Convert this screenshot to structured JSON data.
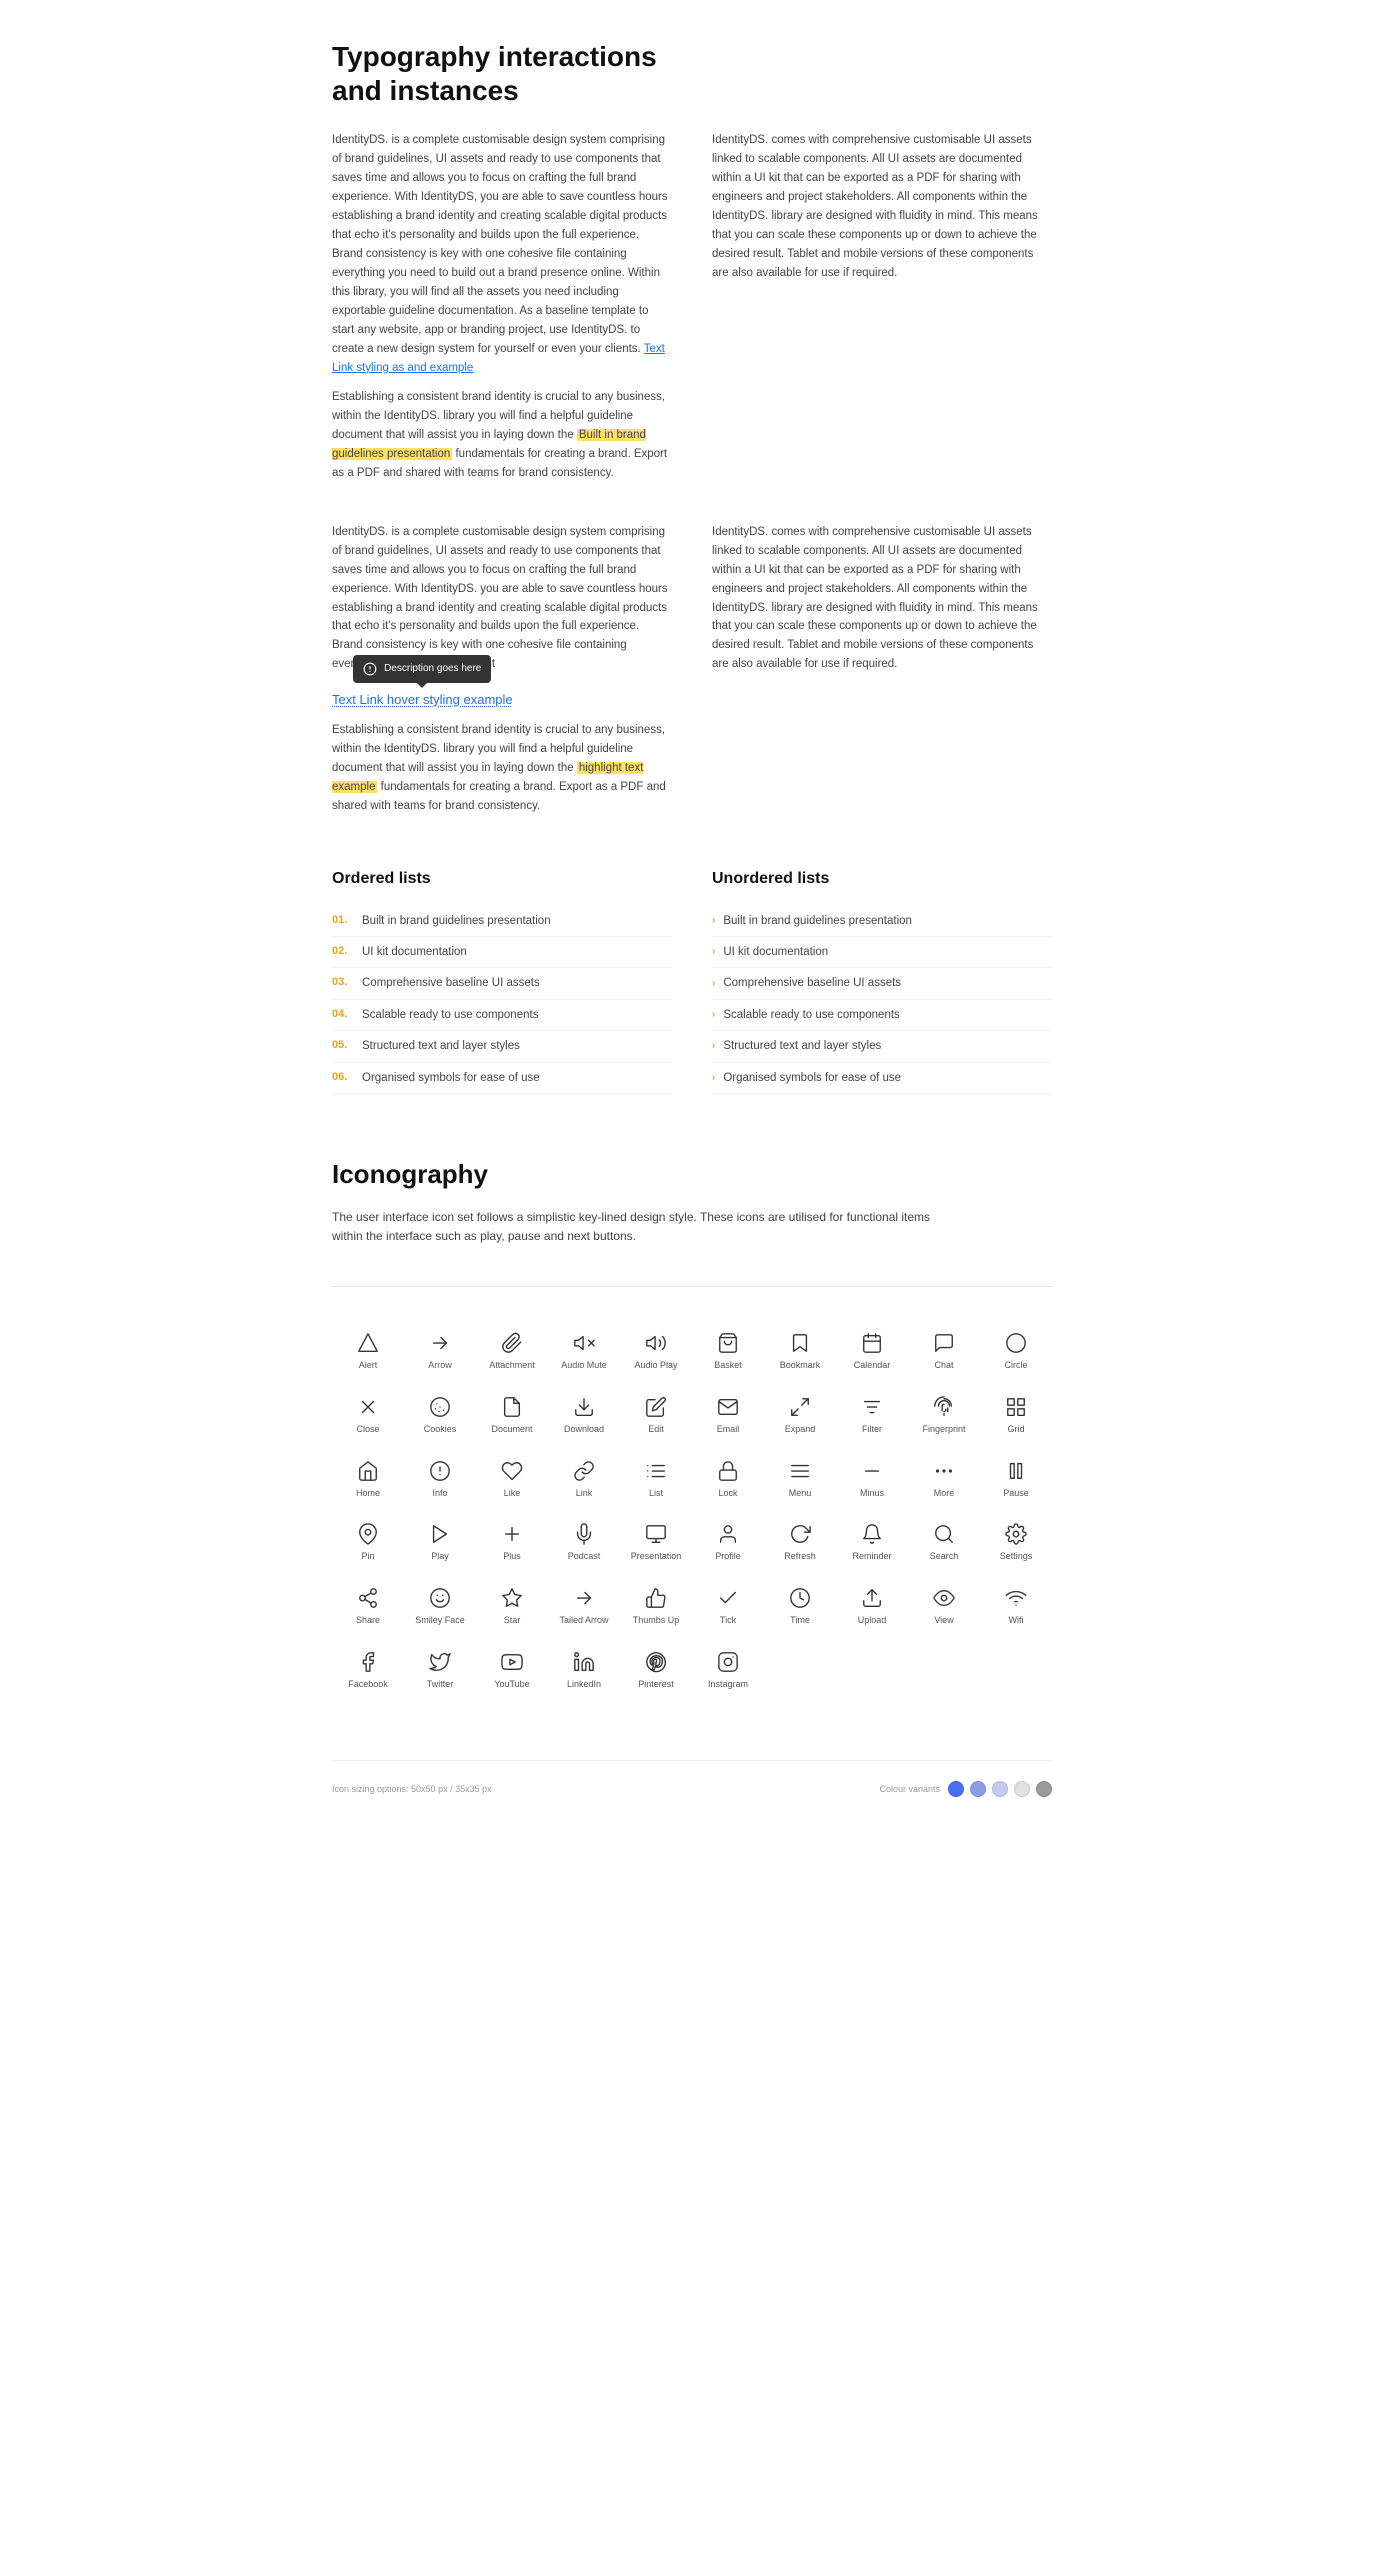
{
  "typography": {
    "title": "Typography interactions\nand instances",
    "col1_p1": "IdentityDS. is a complete customisable design system comprising of brand guidelines, UI assets and ready to use components that saves time and allows you to focus on crafting the full brand experience. With IdentityDS. you are able to save countless hours establishing a brand identity and creating scalable digital products that echo it's personality and builds upon the full experience. Brand consistency is key with one cohesive file containing everything you need to build out a brand presence online. Within this library, you will find all the assets you need including exportable guideline documentation. As a baseline template to start any website, app or branding project, use IdentityDS. to create a new design system for yourself or even your clients.",
    "col1_link": "Text Link styling as and example",
    "col1_p2": "Establishing a consistent brand identity is crucial to any business, within the IdentityDS. library you will find a helpful guideline document that will assist you in laying down the",
    "col1_highlight": "highlight text example",
    "col1_p3": "fundamentals for creating a brand. Export as a PDF and shared with teams for brand consistency.",
    "col2_p1": "IdentityDS. comes with comprehensive customisable UI assets linked to scalable components. All UI assets are documented within a UI kit that can be exported as a PDF for sharing with engineers and project stakeholders. All components within the IdentityDS. library are designed with fluidity in mind. This means that you can scale these components up or down to achieve the desired result. Tablet and mobile versions of these components are also available for use if required.",
    "col1b_p1": "IdentityDS. is a complete customisable design system comprising of brand guidelines, UI assets and ready to use components that saves time and allows you to focus on crafting the full brand experience. With IdentityDS. you are able to save countless hours establishing a brand identity and creating scalable digital products that echo it's personality and builds upon the full experience. Brand consistency is key with one cohesive file containing everything you need to build out",
    "col1b_link": "Text Link hover styling example",
    "col1b_p2": "Establishing a consistent brand identity is crucial to any business, within the IdentityDS. library you will find a helpful guideline document that will assist you in laying down the",
    "col1b_highlight": "highlight text example",
    "col1b_p3": "fundamentals for creating a brand. Export as a PDF and shared with teams for brand consistency.",
    "col2b_p1": "IdentityDS. comes with comprehensive customisable UI assets linked to scalable components. All UI assets are documented within a UI kit that can be exported as a PDF for sharing with engineers and project stakeholders. All components within the IdentityDS. library are designed with fluidity in mind. This means that you can scale these components up or down to achieve the desired result. Tablet and mobile versions of these components are also available for use if required.",
    "tooltip_text": "Description goes here"
  },
  "lists": {
    "ordered_title": "Ordered lists",
    "unordered_title": "Unordered lists",
    "items": [
      "Built in brand guidelines presentation",
      "UI kit documentation",
      "Comprehensive baseline UI assets",
      "Scalable ready to use components",
      "Structured text and layer styles",
      "Organised symbols for ease of use"
    ]
  },
  "iconography": {
    "title": "Iconography",
    "description": "The user interface icon set follows a simplistic key-lined design style. These icons are utilised for functional items within the interface such as play, pause and next buttons.",
    "icons": [
      {
        "name": "Alert",
        "key": "alert"
      },
      {
        "name": "Arrow",
        "key": "arrow"
      },
      {
        "name": "Attachment",
        "key": "attachment"
      },
      {
        "name": "Audio Mute",
        "key": "audio-mute"
      },
      {
        "name": "Audio Play",
        "key": "audio-play"
      },
      {
        "name": "Basket",
        "key": "basket"
      },
      {
        "name": "Bookmark",
        "key": "bookmark"
      },
      {
        "name": "Calendar",
        "key": "calendar"
      },
      {
        "name": "Chat",
        "key": "chat"
      },
      {
        "name": "Circle",
        "key": "circle"
      },
      {
        "name": "Close",
        "key": "close"
      },
      {
        "name": "Cookies",
        "key": "cookies"
      },
      {
        "name": "Document",
        "key": "document"
      },
      {
        "name": "Download",
        "key": "download"
      },
      {
        "name": "Edit",
        "key": "edit"
      },
      {
        "name": "Email",
        "key": "email"
      },
      {
        "name": "Expand",
        "key": "expand"
      },
      {
        "name": "Filter",
        "key": "filter"
      },
      {
        "name": "Fingerprint",
        "key": "fingerprint"
      },
      {
        "name": "Grid",
        "key": "grid"
      },
      {
        "name": "Home",
        "key": "home"
      },
      {
        "name": "Info",
        "key": "info"
      },
      {
        "name": "Like",
        "key": "like"
      },
      {
        "name": "Link",
        "key": "link"
      },
      {
        "name": "List",
        "key": "list"
      },
      {
        "name": "Lock",
        "key": "lock"
      },
      {
        "name": "Menu",
        "key": "menu"
      },
      {
        "name": "Minus",
        "key": "minus"
      },
      {
        "name": "More",
        "key": "more"
      },
      {
        "name": "Pause",
        "key": "pause"
      },
      {
        "name": "Pin",
        "key": "pin"
      },
      {
        "name": "Play",
        "key": "play"
      },
      {
        "name": "Plus",
        "key": "plus"
      },
      {
        "name": "Podcast",
        "key": "podcast"
      },
      {
        "name": "Presentation",
        "key": "presentation"
      },
      {
        "name": "Profile",
        "key": "profile"
      },
      {
        "name": "Refresh",
        "key": "refresh"
      },
      {
        "name": "Reminder",
        "key": "reminder"
      },
      {
        "name": "Search",
        "key": "search"
      },
      {
        "name": "Settings",
        "key": "settings"
      },
      {
        "name": "Share",
        "key": "share"
      },
      {
        "name": "Smiley Face",
        "key": "smiley"
      },
      {
        "name": "Star",
        "key": "star"
      },
      {
        "name": "Tailed Arrow",
        "key": "tailed-arrow"
      },
      {
        "name": "Thumbs Up",
        "key": "thumbs-up"
      },
      {
        "name": "Tick",
        "key": "tick"
      },
      {
        "name": "Time",
        "key": "time"
      },
      {
        "name": "Upload",
        "key": "upload"
      },
      {
        "name": "View",
        "key": "view"
      },
      {
        "name": "Wifi",
        "key": "wifi"
      },
      {
        "name": "Facebook",
        "key": "facebook"
      },
      {
        "name": "Twitter",
        "key": "twitter"
      },
      {
        "name": "YouTube",
        "key": "youtube"
      },
      {
        "name": "LinkedIn",
        "key": "linkedin"
      },
      {
        "name": "Pinterest",
        "key": "pinterest"
      },
      {
        "name": "Instagram",
        "key": "instagram"
      }
    ]
  },
  "footer": {
    "text": "Icon sizing options: 50x50 px  /  35x35 px",
    "color_label": "Colour variants",
    "colors": [
      "#4a6cf7",
      "#8b9de8",
      "#c5caf0",
      "#e0e0e0",
      "#999999"
    ]
  }
}
